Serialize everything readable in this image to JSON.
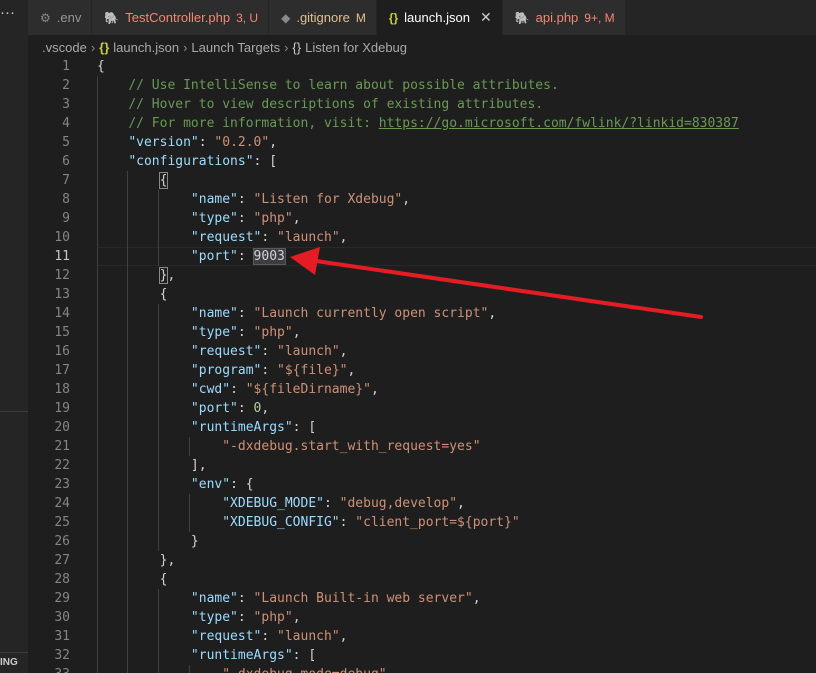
{
  "sidebar": {
    "more": "···",
    "section_fragment": "ING"
  },
  "tabs": [
    {
      "label": ".env",
      "icon": "gear-icon",
      "badge": "",
      "state": "normal"
    },
    {
      "label": "TestController.php",
      "icon": "php-icon",
      "badge": "3, U",
      "state": "error"
    },
    {
      "label": ".gitignore",
      "icon": "git-icon",
      "badge": "M",
      "state": "modified"
    },
    {
      "label": "launch.json",
      "icon": "json-icon",
      "badge": "",
      "state": "active",
      "close": "✕"
    },
    {
      "label": "api.php",
      "icon": "php-icon",
      "badge": "9+, M",
      "state": "error"
    }
  ],
  "breadcrumb": {
    "folder": ".vscode",
    "file": "launch.json",
    "section": "Launch Targets",
    "item": "Listen for Xdebug",
    "separator": "›",
    "json_icon": "{}"
  },
  "editor": {
    "current_line": 11,
    "line_numbers": [
      "1",
      "2",
      "3",
      "4",
      "5",
      "6",
      "7",
      "8",
      "9",
      "10",
      "11",
      "12",
      "13",
      "14",
      "15",
      "16",
      "17",
      "18",
      "19",
      "20",
      "21",
      "22",
      "23",
      "24",
      "25",
      "26",
      "27",
      "28",
      "29",
      "30",
      "31",
      "32",
      "33"
    ],
    "lines": [
      [
        [
          "p",
          "{"
        ]
      ],
      [
        [
          "p",
          "    "
        ],
        [
          "c",
          "// Use IntelliSense to learn about possible attributes."
        ]
      ],
      [
        [
          "p",
          "    "
        ],
        [
          "c",
          "// Hover to view descriptions of existing attributes."
        ]
      ],
      [
        [
          "p",
          "    "
        ],
        [
          "c",
          "// For more information, visit: "
        ],
        [
          "u",
          "https://go.microsoft.com/fwlink/?linkid=830387"
        ]
      ],
      [
        [
          "p",
          "    "
        ],
        [
          "k",
          "\"version\""
        ],
        [
          "p",
          ": "
        ],
        [
          "s",
          "\"0.2.0\""
        ],
        [
          "p",
          ","
        ]
      ],
      [
        [
          "p",
          "    "
        ],
        [
          "k",
          "\"configurations\""
        ],
        [
          "p",
          ": ["
        ]
      ],
      [
        [
          "p",
          "        "
        ],
        [
          "bm",
          "{"
        ]
      ],
      [
        [
          "p",
          "            "
        ],
        [
          "k",
          "\"name\""
        ],
        [
          "p",
          ": "
        ],
        [
          "s",
          "\"Listen for Xdebug\""
        ],
        [
          "p",
          ","
        ]
      ],
      [
        [
          "p",
          "            "
        ],
        [
          "k",
          "\"type\""
        ],
        [
          "p",
          ": "
        ],
        [
          "s",
          "\"php\""
        ],
        [
          "p",
          ","
        ]
      ],
      [
        [
          "p",
          "            "
        ],
        [
          "k",
          "\"request\""
        ],
        [
          "p",
          ": "
        ],
        [
          "s",
          "\"launch\""
        ],
        [
          "p",
          ","
        ]
      ],
      [
        [
          "p",
          "            "
        ],
        [
          "k",
          "\"port\""
        ],
        [
          "p",
          ": "
        ],
        [
          "selw",
          "9003"
        ]
      ],
      [
        [
          "p",
          "        "
        ],
        [
          "bm",
          "}"
        ],
        [
          "p",
          ","
        ]
      ],
      [
        [
          "p",
          "        {"
        ]
      ],
      [
        [
          "p",
          "            "
        ],
        [
          "k",
          "\"name\""
        ],
        [
          "p",
          ": "
        ],
        [
          "s",
          "\"Launch currently open script\""
        ],
        [
          "p",
          ","
        ]
      ],
      [
        [
          "p",
          "            "
        ],
        [
          "k",
          "\"type\""
        ],
        [
          "p",
          ": "
        ],
        [
          "s",
          "\"php\""
        ],
        [
          "p",
          ","
        ]
      ],
      [
        [
          "p",
          "            "
        ],
        [
          "k",
          "\"request\""
        ],
        [
          "p",
          ": "
        ],
        [
          "s",
          "\"launch\""
        ],
        [
          "p",
          ","
        ]
      ],
      [
        [
          "p",
          "            "
        ],
        [
          "k",
          "\"program\""
        ],
        [
          "p",
          ": "
        ],
        [
          "s",
          "\"${file}\""
        ],
        [
          "p",
          ","
        ]
      ],
      [
        [
          "p",
          "            "
        ],
        [
          "k",
          "\"cwd\""
        ],
        [
          "p",
          ": "
        ],
        [
          "s",
          "\"${fileDirname}\""
        ],
        [
          "p",
          ","
        ]
      ],
      [
        [
          "p",
          "            "
        ],
        [
          "k",
          "\"port\""
        ],
        [
          "p",
          ": "
        ],
        [
          "n",
          "0"
        ],
        [
          "p",
          ","
        ]
      ],
      [
        [
          "p",
          "            "
        ],
        [
          "k",
          "\"runtimeArgs\""
        ],
        [
          "p",
          ": ["
        ]
      ],
      [
        [
          "p",
          "                "
        ],
        [
          "s",
          "\"-dxdebug.start_with_request=yes\""
        ]
      ],
      [
        [
          "p",
          "            ],"
        ]
      ],
      [
        [
          "p",
          "            "
        ],
        [
          "k",
          "\"env\""
        ],
        [
          "p",
          ": {"
        ]
      ],
      [
        [
          "p",
          "                "
        ],
        [
          "k",
          "\"XDEBUG_MODE\""
        ],
        [
          "p",
          ": "
        ],
        [
          "s",
          "\"debug,develop\""
        ],
        [
          "p",
          ","
        ]
      ],
      [
        [
          "p",
          "                "
        ],
        [
          "k",
          "\"XDEBUG_CONFIG\""
        ],
        [
          "p",
          ": "
        ],
        [
          "s",
          "\"client_port=${port}\""
        ]
      ],
      [
        [
          "p",
          "            }"
        ]
      ],
      [
        [
          "p",
          "        },"
        ]
      ],
      [
        [
          "p",
          "        {"
        ]
      ],
      [
        [
          "p",
          "            "
        ],
        [
          "k",
          "\"name\""
        ],
        [
          "p",
          ": "
        ],
        [
          "s",
          "\"Launch Built-in web server\""
        ],
        [
          "p",
          ","
        ]
      ],
      [
        [
          "p",
          "            "
        ],
        [
          "k",
          "\"type\""
        ],
        [
          "p",
          ": "
        ],
        [
          "s",
          "\"php\""
        ],
        [
          "p",
          ","
        ]
      ],
      [
        [
          "p",
          "            "
        ],
        [
          "k",
          "\"request\""
        ],
        [
          "p",
          ": "
        ],
        [
          "s",
          "\"launch\""
        ],
        [
          "p",
          ","
        ]
      ],
      [
        [
          "p",
          "            "
        ],
        [
          "k",
          "\"runtimeArgs\""
        ],
        [
          "p",
          ": ["
        ]
      ],
      [
        [
          "p",
          "                "
        ],
        [
          "s",
          "\"-dxdebug.mode=debug\""
        ],
        [
          "p",
          ","
        ]
      ]
    ]
  },
  "annotation": {
    "color": "#e51c23",
    "target": "port 9003"
  },
  "colors": {
    "background": "#1e1e1e",
    "tabbar": "#252526",
    "key": "#9cdcfe",
    "string": "#ce9178",
    "number": "#b5cea8",
    "comment": "#6a9955"
  }
}
